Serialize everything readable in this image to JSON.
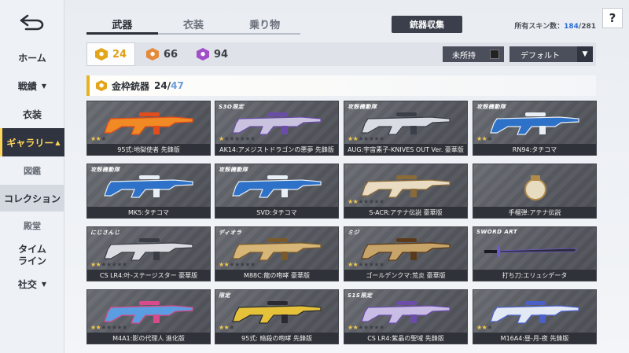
{
  "sidebar": {
    "back_label": "back",
    "items": [
      {
        "label": "ホーム"
      },
      {
        "label": "戦績",
        "caret": "▼"
      },
      {
        "label": "衣装"
      },
      {
        "label": "ギャラリー",
        "caret": "▲"
      },
      {
        "label": "図鑑"
      },
      {
        "label": "コレクション"
      },
      {
        "label": "殿堂"
      },
      {
        "label": "タイム\nライン"
      },
      {
        "label": "社交",
        "caret": "▼"
      }
    ]
  },
  "tabs": [
    {
      "label": "武器"
    },
    {
      "label": "衣装"
    },
    {
      "label": "乗り物"
    }
  ],
  "collect_button": "銃器収集",
  "owned_skins": {
    "label": "所有スキン数：",
    "current": "184",
    "separator": "/",
    "total": "281"
  },
  "help_label": "?",
  "filters": {
    "rarities": [
      {
        "name": "gold",
        "count": "24",
        "color": "#e3a51a"
      },
      {
        "name": "orange",
        "count": "66",
        "color": "#e48a3a"
      },
      {
        "name": "purple",
        "count": "94",
        "color": "#a14ec9"
      }
    ],
    "unowned_label": "未所持",
    "sort_label": "デフォルト",
    "sort_arrow": "▼"
  },
  "section": {
    "title": "金枠銃器",
    "owned": "24",
    "separator": "/",
    "total": "47"
  },
  "cards": [
    {
      "name": "95式:地獄使者 先鋒版",
      "stars": 3,
      "lit": 2,
      "brand": "",
      "color": "#f08a24",
      "accent": "#e44c1c"
    },
    {
      "name": "AK14:アメジストドラゴンの悪夢 先鋒版",
      "stars": 7,
      "lit": 1,
      "brand": "S3O限定",
      "color": "#c9c3e0",
      "accent": "#6b4ca8"
    },
    {
      "name": "AUG:宇宙素子-KNIVES OUT Ver. 豪華版",
      "stars": 7,
      "lit": 2,
      "brand": "攻殻機動隊",
      "color": "#d9dde3",
      "accent": "#3a3f48"
    },
    {
      "name": "RN94:タチコマ",
      "stars": 3,
      "lit": 2,
      "brand": "攻殻機動隊",
      "color": "#2d72c8",
      "accent": "#e8eef6"
    },
    {
      "name": "MK5:タチコマ",
      "stars": 0,
      "lit": 0,
      "brand": "攻殻機動隊",
      "color": "#2d72c8",
      "accent": "#e8eef6"
    },
    {
      "name": "SVD:タチコマ",
      "stars": 0,
      "lit": 0,
      "brand": "攻殻機動隊",
      "color": "#2d72c8",
      "accent": "#e8eef6"
    },
    {
      "name": "S-ACR:アテナ伝説 豪華版",
      "stars": 7,
      "lit": 2,
      "brand": "",
      "color": "#e9dcc2",
      "accent": "#8b6a3a"
    },
    {
      "name": "手榴弾:アテナ伝説",
      "stars": 0,
      "lit": 0,
      "brand": "",
      "color": "#e8dcc0",
      "accent": "#b08a4a"
    },
    {
      "name": "CS LR4:叶-ステージスター 豪華版",
      "stars": 7,
      "lit": 2,
      "brand": "にじさんじ",
      "color": "#dcdde2",
      "accent": "#3a3d44"
    },
    {
      "name": "M88C:龍の咆哮 豪華版",
      "stars": 7,
      "lit": 2,
      "brand": "ディオラ",
      "color": "#d7b678",
      "accent": "#7a5a2a"
    },
    {
      "name": "ゴールデンクマ:荒炎 豪華版",
      "stars": 7,
      "lit": 2,
      "brand": "ミジ",
      "color": "#c7a46a",
      "accent": "#5a3a1a"
    },
    {
      "name": "打ち刀:エリュシデータ",
      "stars": 0,
      "lit": 0,
      "brand": "SWORD ART",
      "color": "#2a2c38",
      "accent": "#6a5acd"
    },
    {
      "name": "M4A1:影の代理人 進化版",
      "stars": 7,
      "lit": 2,
      "brand": "",
      "color": "#5a9de0",
      "accent": "#d94a8c"
    },
    {
      "name": "95式: 暗殺の咆哮 先鋒版",
      "stars": 3,
      "lit": 2,
      "brand": "限定",
      "color": "#e6c23a",
      "accent": "#2a2a30"
    },
    {
      "name": "CS LR4:紫晶の聖域 先鋒版",
      "stars": 7,
      "lit": 2,
      "brand": "S1S限定",
      "color": "#c9bde6",
      "accent": "#6b4ca8"
    },
    {
      "name": "M16A4:昼-月-夜 先鋒版",
      "stars": 3,
      "lit": 2,
      "brand": "",
      "color": "#e2e8f4",
      "accent": "#4b5fc9"
    }
  ]
}
